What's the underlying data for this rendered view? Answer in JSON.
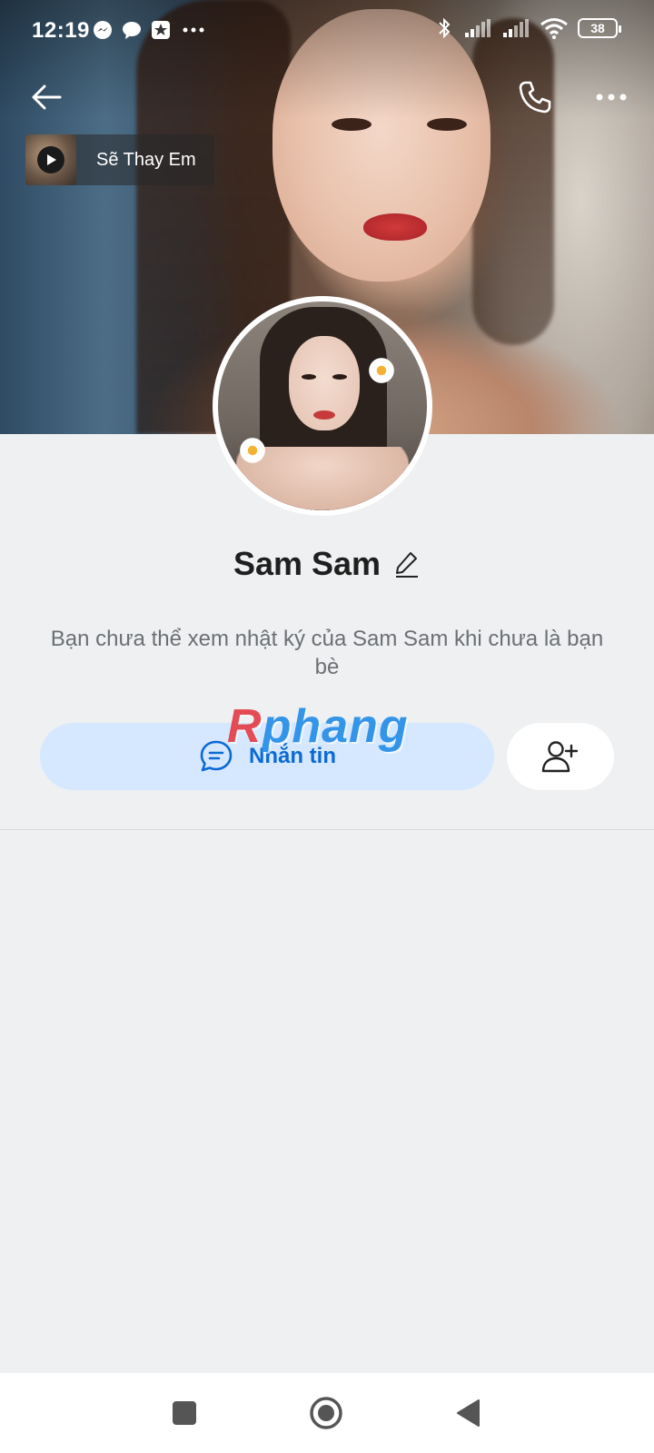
{
  "status_bar": {
    "time": "12:19",
    "left_icons": [
      "messenger-icon",
      "chat-bubble-icon",
      "star-app-icon",
      "more-dots-icon"
    ],
    "right_icons": [
      "bluetooth-icon",
      "signal-icon",
      "signal-icon",
      "wifi-icon"
    ],
    "battery": "38"
  },
  "header": {
    "back_icon": "arrow-left-icon",
    "call_icon": "phone-icon",
    "more_icon": "more-horizontal-icon"
  },
  "music": {
    "title": "Sẽ Thay Em"
  },
  "profile": {
    "name": "Sam Sam",
    "notice": "Bạn chưa thể xem nhật ký của Sam Sam khi chưa là bạn bè"
  },
  "actions": {
    "message_label": "Nhắn tin",
    "add_friend_icon": "add-user-icon"
  },
  "watermark": {
    "first_letter": "R",
    "rest": "phang"
  },
  "colors": {
    "accent": "#0b6ad4",
    "message_button_bg": "#d6e8ff",
    "page_bg": "#eef0f2"
  }
}
